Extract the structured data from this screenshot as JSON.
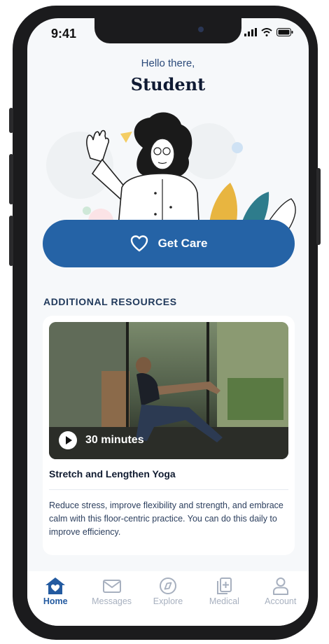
{
  "status_bar": {
    "time": "9:41"
  },
  "header": {
    "greeting": "Hello there,",
    "user_name": "Student"
  },
  "primary_action": {
    "label": "Get Care",
    "icon": "heart-icon"
  },
  "resources": {
    "section_title": "ADDITIONAL RESOURCES",
    "card": {
      "duration": "30 minutes",
      "title": "Stretch and Lengthen Yoga",
      "description": "Reduce stress, improve flexibility and strength, and embrace calm with this floor-centric practice. You can do this daily to improve efficiency."
    }
  },
  "tab_bar": {
    "items": [
      {
        "label": "Home",
        "icon": "home-heart-icon",
        "active": true
      },
      {
        "label": "Messages",
        "icon": "envelope-icon",
        "active": false
      },
      {
        "label": "Explore",
        "icon": "compass-icon",
        "active": false
      },
      {
        "label": "Medical",
        "icon": "medical-docs-icon",
        "active": false
      },
      {
        "label": "Account",
        "icon": "person-icon",
        "active": false
      }
    ]
  },
  "colors": {
    "primary": "#2563a6",
    "heading": "#0f1a33",
    "accent_text": "#2b4a7a",
    "inactive_tab": "#a7b0bf"
  }
}
